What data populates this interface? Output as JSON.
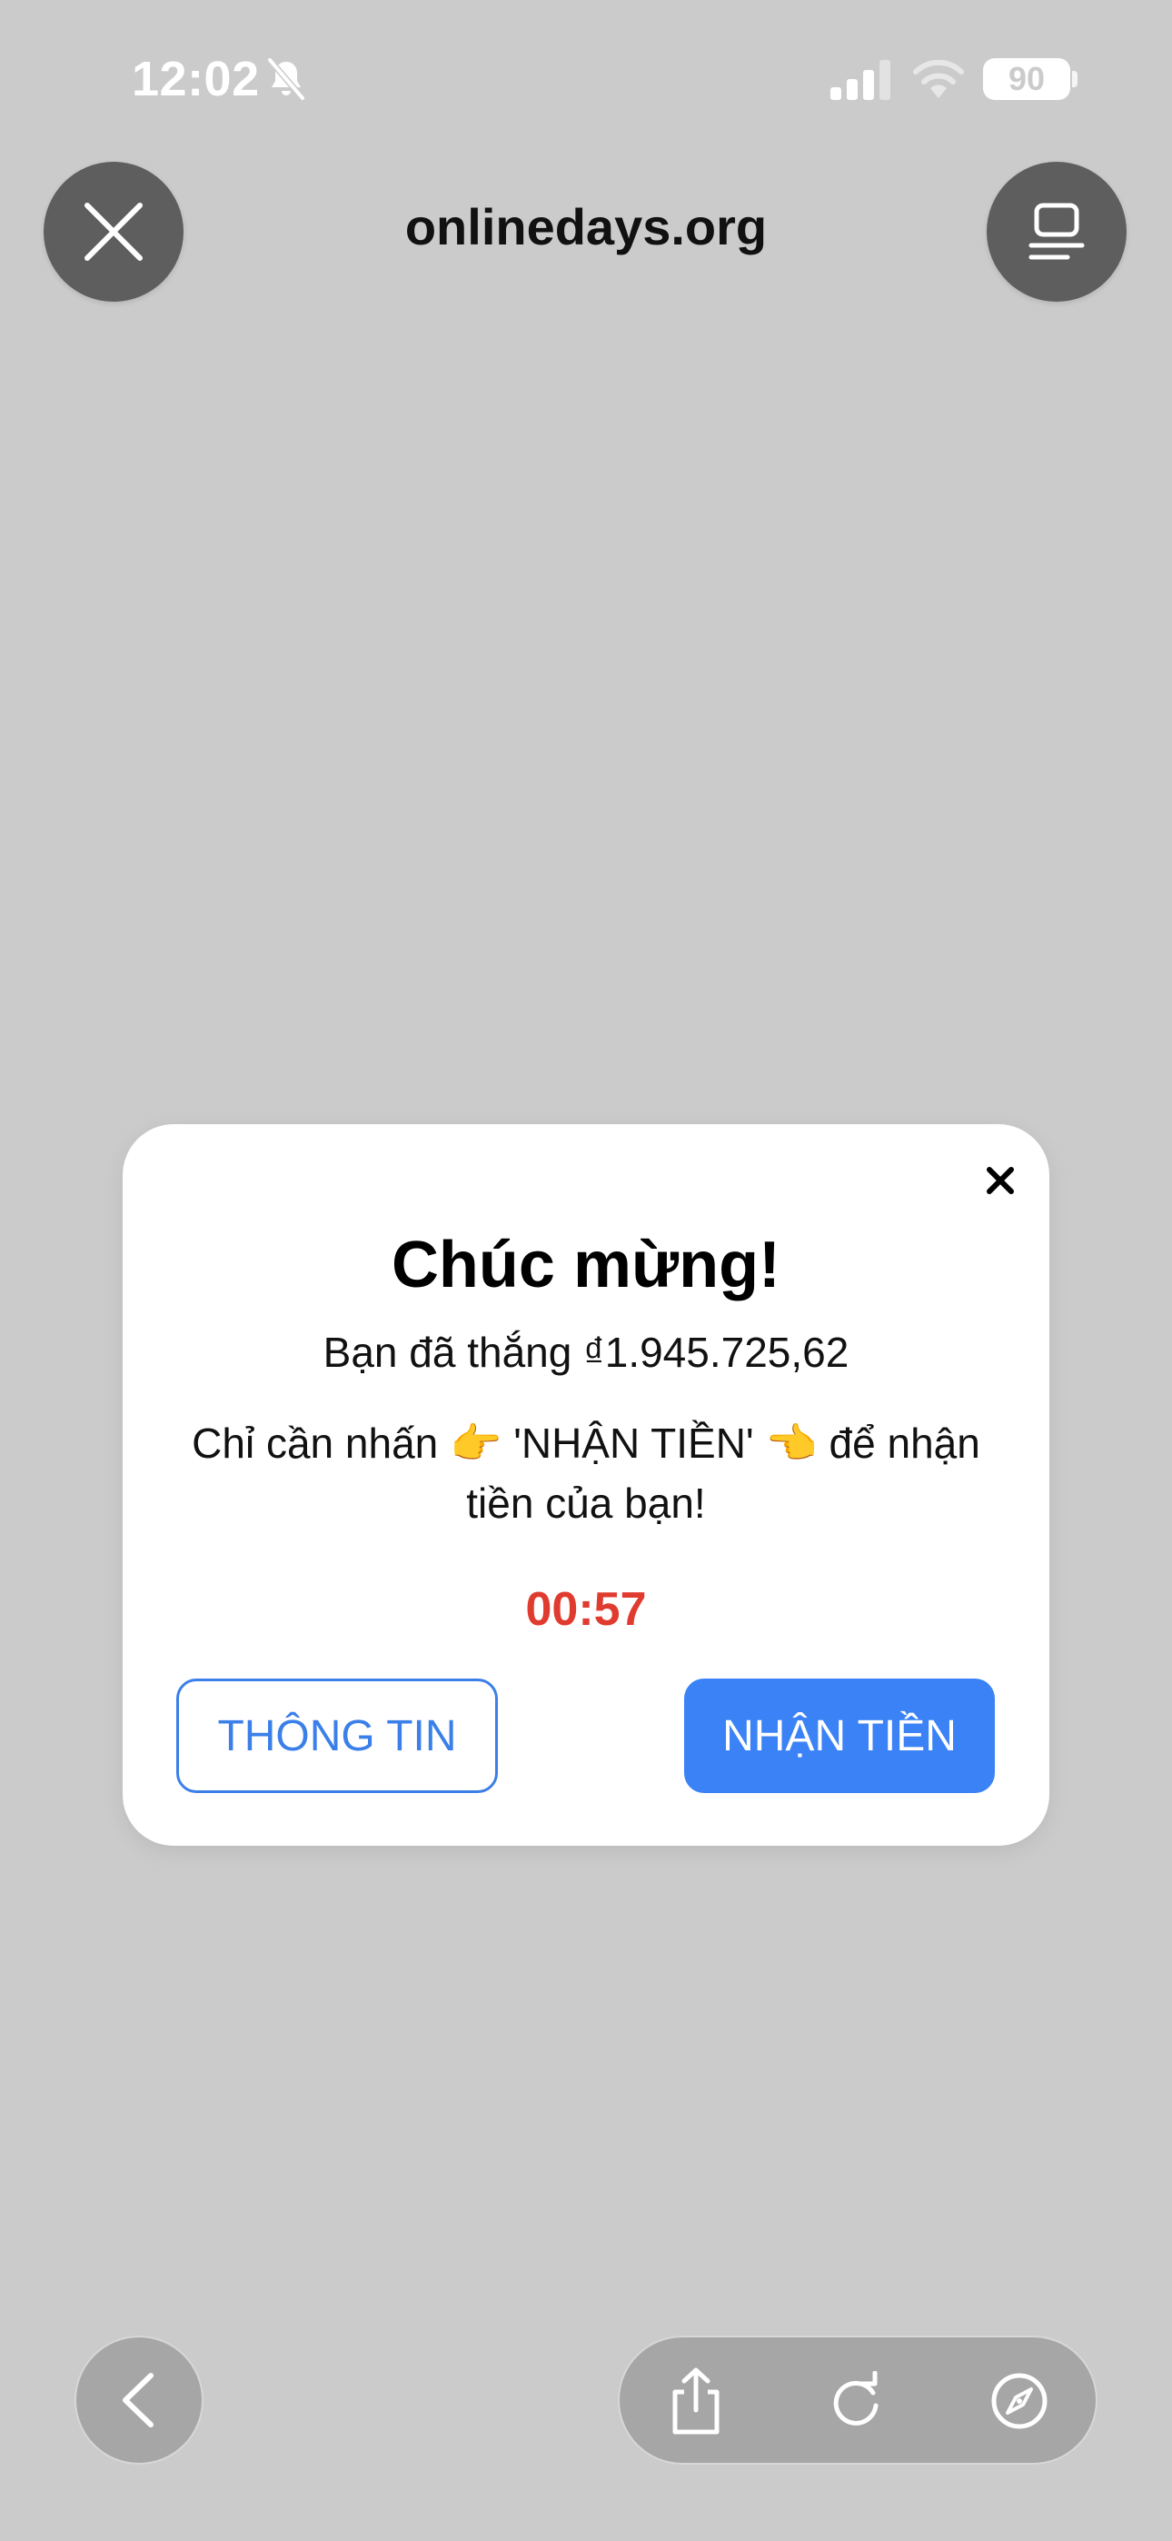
{
  "status_bar": {
    "time": "12:02",
    "battery": "90",
    "icons": [
      "bell-slash-icon",
      "signal-icon",
      "wifi-icon",
      "battery-icon"
    ]
  },
  "browser": {
    "domain": "onlinedays.org",
    "close_icon": "close-icon",
    "tabs_icon": "tabs-icon",
    "bottom_icons": [
      "back-icon",
      "share-icon",
      "reload-icon",
      "compass-icon"
    ]
  },
  "dialog": {
    "title": "Chúc mừng!",
    "amount_text": "Bạn đã thắng ₫1.945.725,62",
    "instruction_text": "Chỉ cần nhấn 👉 'NHẬN TIỀN' 👈 để nhận tiền của bạn!",
    "countdown": "00:57",
    "info_button": "THÔNG TIN",
    "claim_button": "NHẬN TIỀN"
  },
  "colors": {
    "page_background": "#cbcbcb",
    "accent_blue": "#3b82f6",
    "countdown_red": "#e03b2f",
    "toolbar_button": "#5e5e5e"
  }
}
